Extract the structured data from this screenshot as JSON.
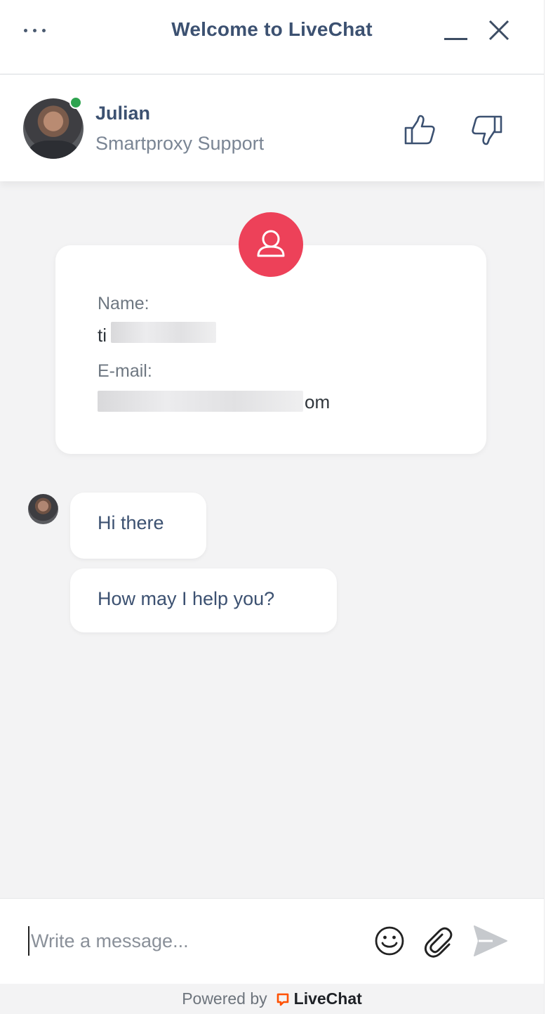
{
  "header": {
    "title": "Welcome to LiveChat",
    "menu_icon": "more-dots-icon",
    "minimize_icon": "minimize-icon",
    "close_icon": "close-icon"
  },
  "agent": {
    "name": "Julian",
    "role": "Smartproxy Support",
    "status_color": "#2ea34f",
    "rate_good_icon": "thumbs-up-icon",
    "rate_bad_icon": "thumbs-down-icon"
  },
  "prechat_form": {
    "badge_icon": "user-icon",
    "badge_color": "#ed4159",
    "name_label": "Name:",
    "name_value_visible": "ti",
    "email_label": "E-mail:",
    "email_value_visible": "om"
  },
  "messages": [
    {
      "text": "Hi there"
    },
    {
      "text": "How may I help you?"
    }
  ],
  "composer": {
    "placeholder": "Write a message...",
    "emoji_icon": "emoji-icon",
    "attach_icon": "paperclip-icon",
    "send_icon": "send-icon"
  },
  "footer": {
    "powered_by": "Powered by",
    "brand": "LiveChat",
    "brand_color": "#ff5100"
  }
}
